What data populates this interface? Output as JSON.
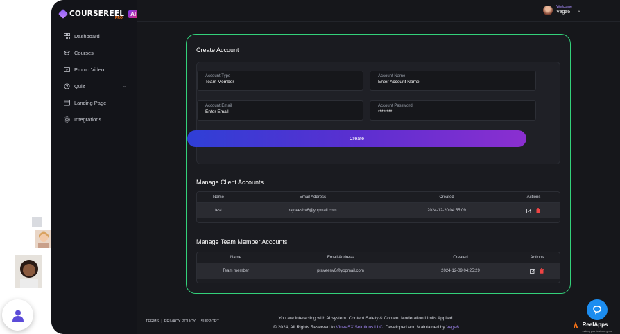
{
  "brand": {
    "name": "COURSEREEL",
    "badge": "AI",
    "sub": "PRO"
  },
  "sidebar": {
    "items": [
      {
        "label": "Dashboard",
        "icon": "grid-icon"
      },
      {
        "label": "Courses",
        "icon": "courses-icon"
      },
      {
        "label": "Promo Video",
        "icon": "play-icon"
      },
      {
        "label": "Quiz",
        "icon": "quiz-icon",
        "expandable": true
      },
      {
        "label": "Landing Page",
        "icon": "landing-icon"
      },
      {
        "label": "Integrations",
        "icon": "integrations-icon"
      }
    ]
  },
  "header": {
    "welcome": "Welcome",
    "username": "Vega6"
  },
  "create_account": {
    "title": "Create Account",
    "account_type_label": "Account Type",
    "account_type_value": "Team Member",
    "account_name_label": "Account Name",
    "account_name_placeholder": "Enter Account Name",
    "account_email_label": "Account Email",
    "account_email_placeholder": "Enter Email",
    "account_password_label": "Account Password",
    "account_password_value": "********",
    "button": "Create"
  },
  "client_accounts": {
    "title": "Manage Client Accounts",
    "columns": [
      "Name",
      "Email Address",
      "Created",
      "Actions"
    ],
    "rows": [
      {
        "name": "test",
        "email": "rajneeshv6@yopmail.com",
        "created": "2024-12-20 04:55:09"
      }
    ]
  },
  "team_accounts": {
    "title": "Manage Team Member Accounts",
    "columns": [
      "Name",
      "Email Address",
      "Created",
      "Actions"
    ],
    "rows": [
      {
        "name": "Team member",
        "email": "praveenv6@yopmail.com",
        "created": "2024-12-09 04:25:29"
      }
    ]
  },
  "footer": {
    "links": [
      "TERMS",
      "PRIVACY POLICY",
      "SUPPORT"
    ],
    "line1": "You are interacting with AI system. Content Safety & Content Moderation Limits Applied.",
    "line2_prefix": "© 2024, All Rights Reserved to ",
    "line2_company": "VineaSX Solutions LLC.",
    "line2_middle": " Developed and Maintained by ",
    "line2_dev": "Vega6",
    "brand_name": "ReelApps",
    "brand_tag": "making your business grow"
  },
  "colors": {
    "accent_green": "#33d17a",
    "button_gradient_start": "#2f3fd6",
    "button_gradient_end": "#8b2fd0",
    "edit_icon": "#e5e7eb",
    "delete_icon": "#ef4444",
    "help_button": "#1c8df0"
  }
}
